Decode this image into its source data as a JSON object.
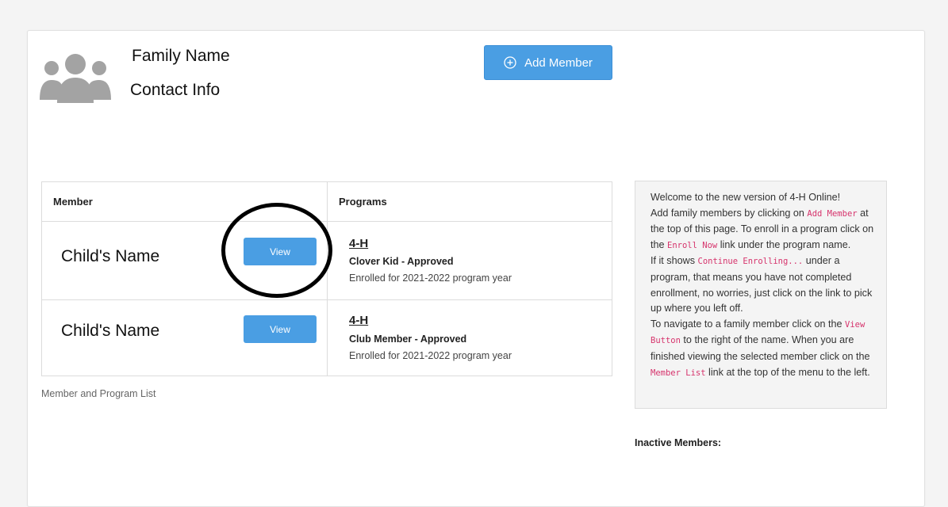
{
  "family": {
    "name": "Family Name",
    "contact": "Contact Info"
  },
  "toolbar": {
    "add_member_label": "Add Member"
  },
  "table": {
    "headers": [
      "Member",
      "Programs"
    ],
    "rows": [
      {
        "member": "Child's Name",
        "view_label": "View",
        "program": "4-H",
        "status": "Clover Kid - Approved",
        "enrolled": "Enrolled for 2021-2022 program year"
      },
      {
        "member": "Child's Name",
        "view_label": "View",
        "program": "4-H",
        "status": "Club Member - Approved",
        "enrolled": "Enrolled for 2021-2022 program year"
      }
    ],
    "caption": "Member and Program List"
  },
  "info": {
    "welcome": "Welcome to the new version of 4-H Online!",
    "add_pre": "Add family members by clicking on ",
    "add_code": "Add Member",
    "add_post": " at the top of this page. To enroll in a program click on the ",
    "enroll_code": "Enroll Now",
    "enroll_post": " link under the program name.",
    "cont_pre": "If it shows ",
    "cont_code": "Continue Enrolling...",
    "cont_post": " under a program, that means you have not completed enrollment, no worries, just click on the link to pick up where you left off.",
    "nav_pre": "To navigate to a family member click on the ",
    "nav_code": "View Button",
    "nav_post": " to the right of the name. When you are finished viewing the selected member click on the ",
    "list_code": "Member List",
    "list_post": " link at the top of the menu to the left."
  },
  "inactive_label": "Inactive Members:",
  "colors": {
    "accent": "#4a9ee3",
    "code": "#d6336c",
    "avatar": "#a3a3a3"
  }
}
